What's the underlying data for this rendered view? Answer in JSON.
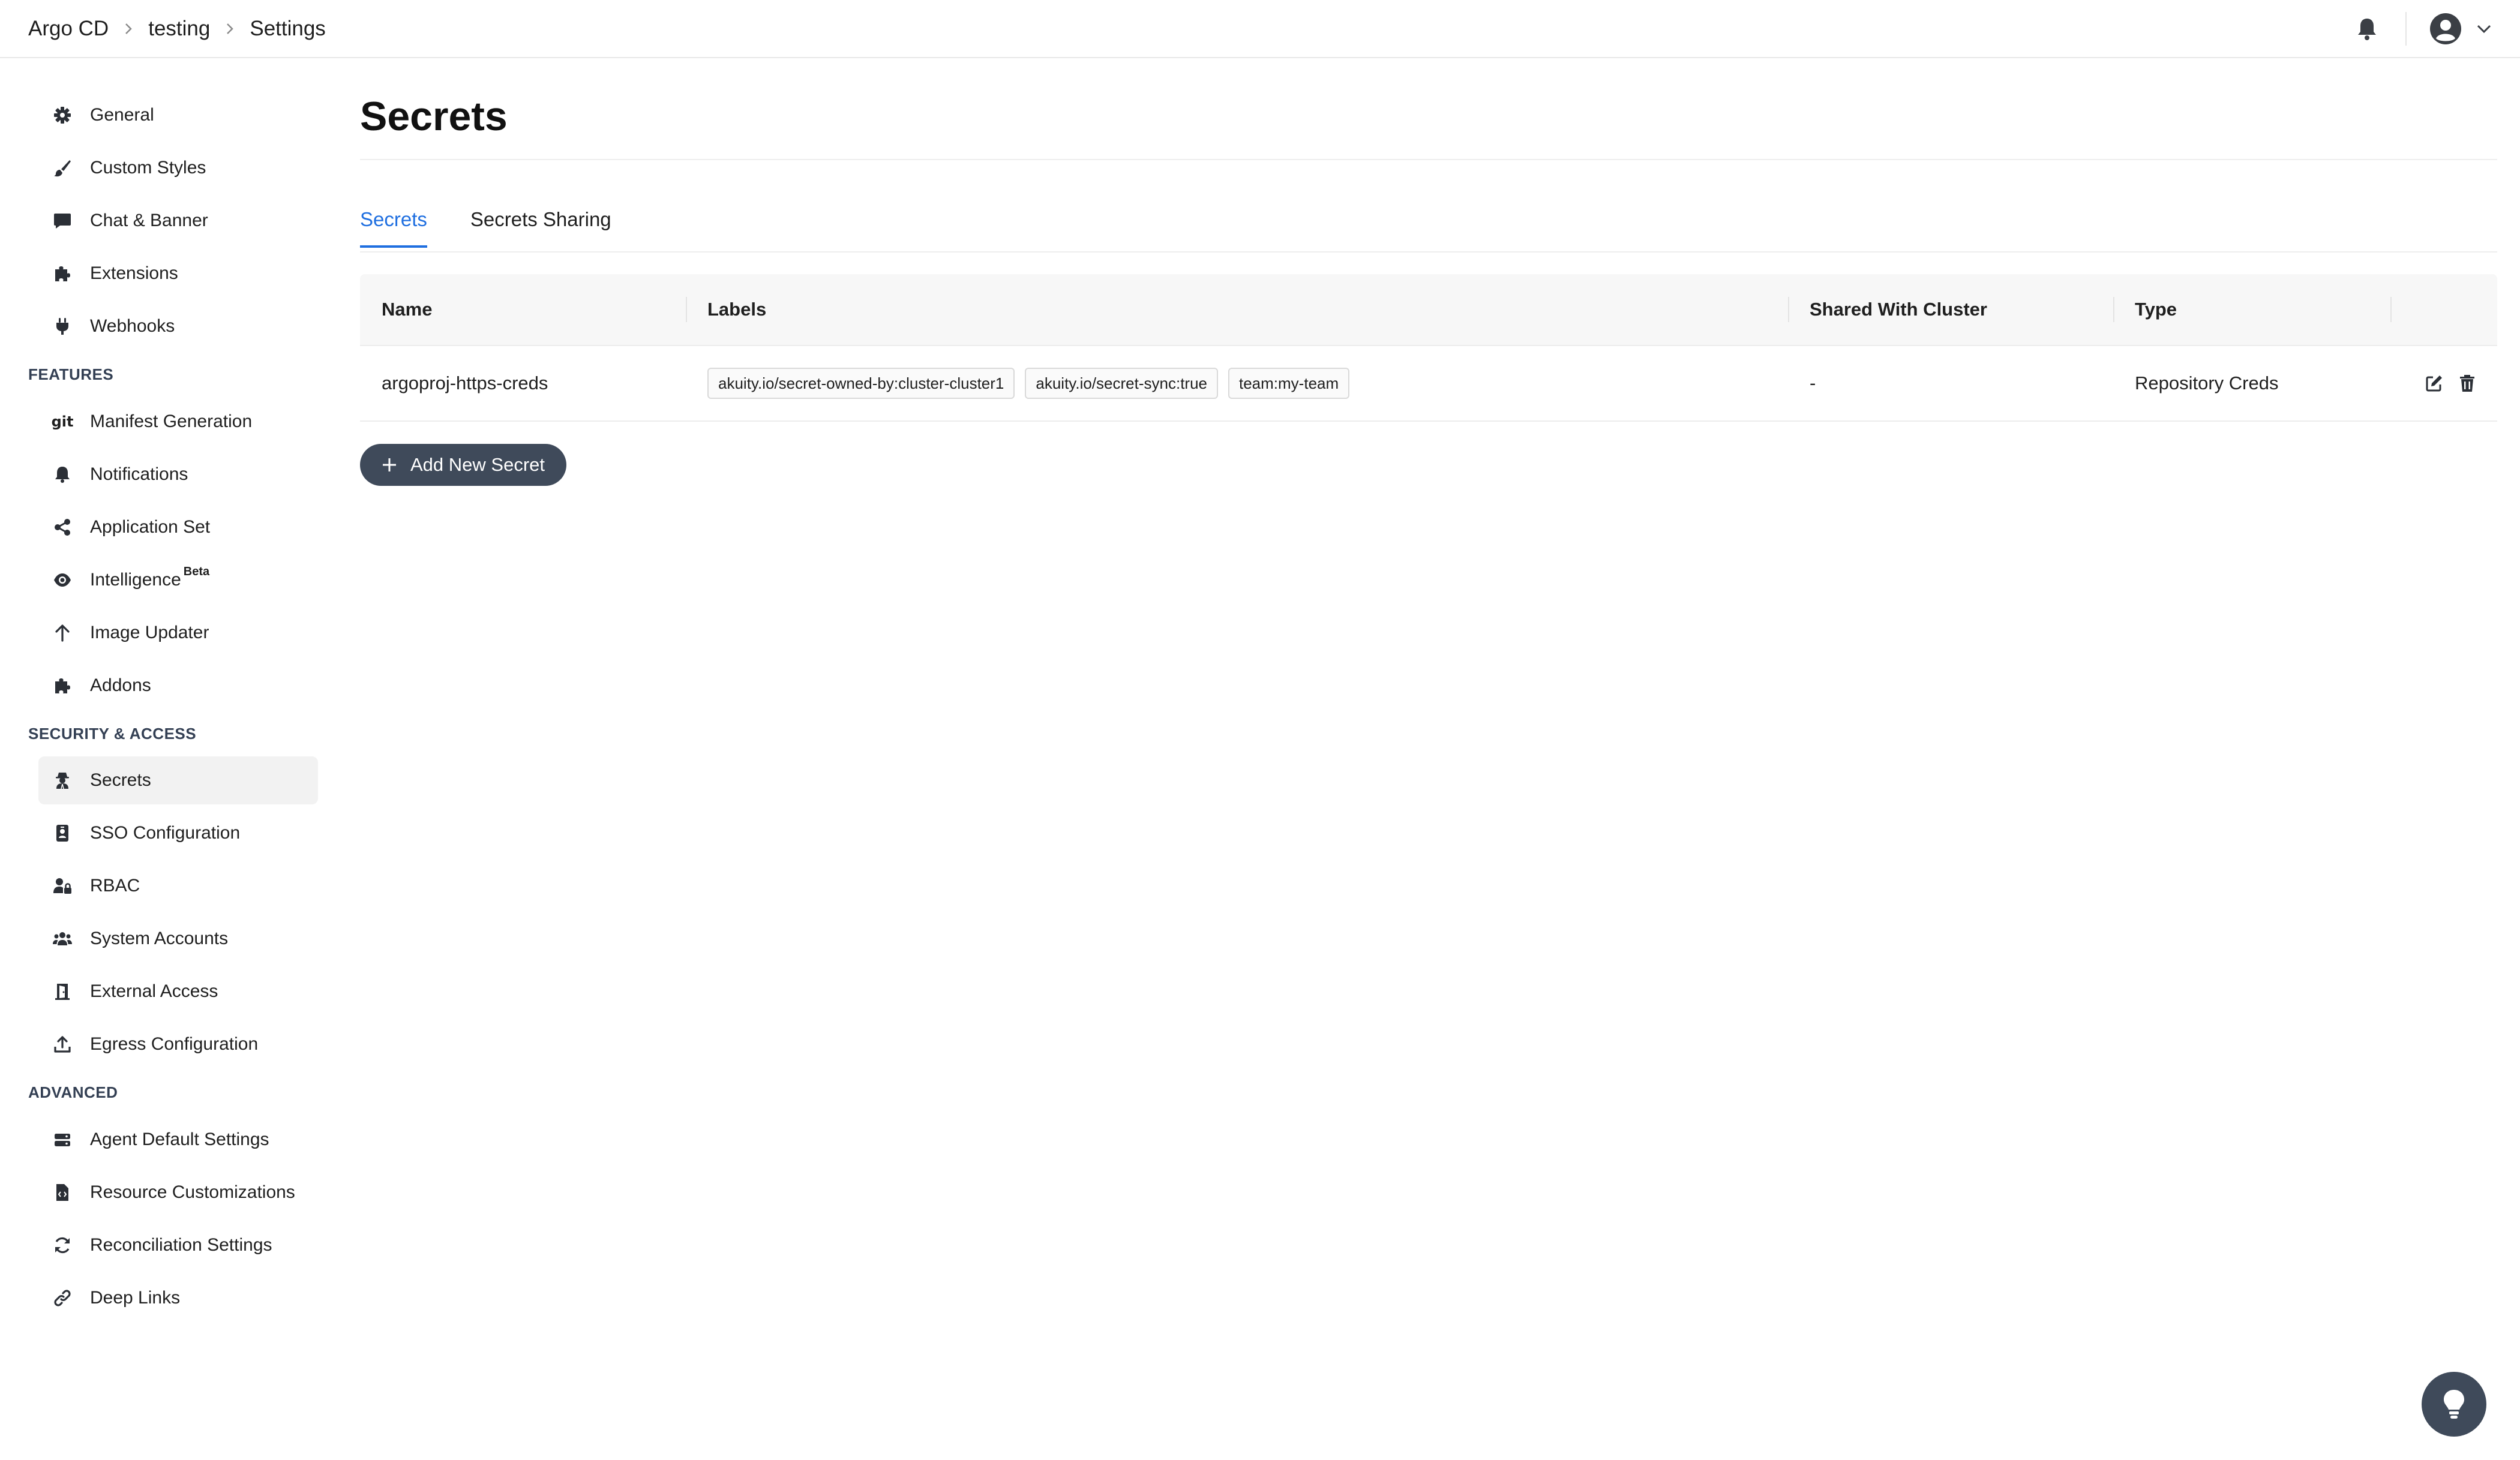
{
  "breadcrumb": {
    "items": [
      "Argo CD",
      "testing",
      "Settings"
    ]
  },
  "sidebar": {
    "general": [
      {
        "label": "General",
        "icon": "gear-icon"
      },
      {
        "label": "Custom Styles",
        "icon": "paintbrush-icon"
      },
      {
        "label": "Chat & Banner",
        "icon": "chat-icon"
      },
      {
        "label": "Extensions",
        "icon": "puzzle-icon"
      },
      {
        "label": "Webhooks",
        "icon": "plug-icon"
      }
    ],
    "features": {
      "title": "FEATURES",
      "items": [
        {
          "label": "Manifest Generation",
          "icon": "git-icon",
          "icon_text": "git"
        },
        {
          "label": "Notifications",
          "icon": "bell-icon"
        },
        {
          "label": "Application Set",
          "icon": "share-icon"
        },
        {
          "label": "Intelligence",
          "icon": "eye-icon",
          "badge": "Beta"
        },
        {
          "label": "Image Updater",
          "icon": "arrow-up-icon"
        },
        {
          "label": "Addons",
          "icon": "puzzle-icon"
        }
      ]
    },
    "security": {
      "title": "SECURITY & ACCESS",
      "items": [
        {
          "label": "Secrets",
          "icon": "user-secret-icon",
          "active": true
        },
        {
          "label": "SSO Configuration",
          "icon": "id-badge-icon"
        },
        {
          "label": "RBAC",
          "icon": "user-lock-icon"
        },
        {
          "label": "System Accounts",
          "icon": "users-icon"
        },
        {
          "label": "External Access",
          "icon": "door-icon"
        },
        {
          "label": "Egress Configuration",
          "icon": "upload-icon"
        }
      ]
    },
    "advanced": {
      "title": "ADVANCED",
      "items": [
        {
          "label": "Agent Default Settings",
          "icon": "server-icon"
        },
        {
          "label": "Resource Customizations",
          "icon": "file-code-icon"
        },
        {
          "label": "Reconciliation Settings",
          "icon": "sync-icon"
        },
        {
          "label": "Deep Links",
          "icon": "link-icon"
        }
      ]
    }
  },
  "main": {
    "title": "Secrets",
    "tabs": [
      {
        "label": "Secrets",
        "active": true
      },
      {
        "label": "Secrets Sharing",
        "active": false
      }
    ],
    "table": {
      "columns": [
        "Name",
        "Labels",
        "Shared With Cluster",
        "Type",
        ""
      ],
      "rows": [
        {
          "name": "argoproj-https-creds",
          "labels": [
            "akuity.io/secret-owned-by:cluster-cluster1",
            "akuity.io/secret-sync:true",
            "team:my-team"
          ],
          "shared_with_cluster": "-",
          "type": "Repository Creds"
        }
      ]
    },
    "add_button_label": "Add New Secret"
  },
  "colors": {
    "accent": "#1f6fe0",
    "button_bg": "#3f4a5a",
    "active_nav_bg": "#f2f2f2"
  }
}
